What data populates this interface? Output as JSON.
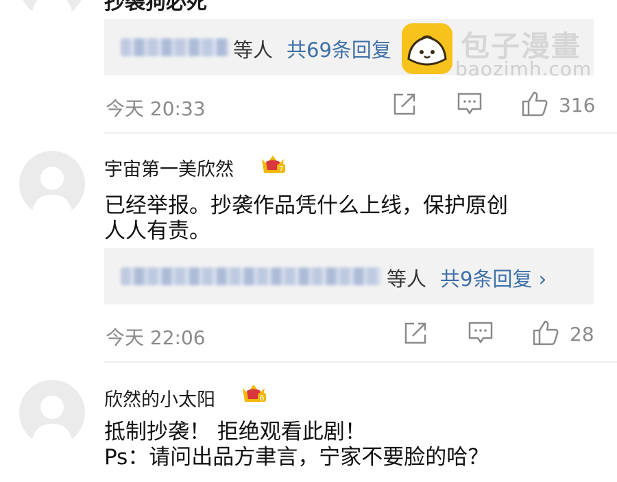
{
  "comment_top": {
    "username_partial": "抄袭狗必死",
    "reply_suffix": "等人",
    "reply_link": "共69条回复",
    "time": "今天 20:33",
    "likes": "316"
  },
  "comment_2": {
    "username": "宇宙第一美欣然",
    "badge_level": "7",
    "content_line1": "已经举报。抄袭作品凭什么上线，保护原创",
    "content_line2": "人人有责。",
    "reply_suffix": "等人",
    "reply_link": "共9条回复 ›",
    "time": "今天 22:06",
    "likes": "28"
  },
  "comment_3": {
    "username": "欣然的小太阳",
    "badge_level": "6",
    "content_line1": "抵制抄袭！ 拒绝观看此剧！",
    "content_line2": "Ps：请问出品方聿言，宁家不要脸的哈？"
  },
  "watermark": {
    "title": "包子漫畫",
    "url": "baozimh.com"
  },
  "colors": {
    "link": "#3d6fa8",
    "meta": "#8a8a8a",
    "reply_bg": "#f2f2f2",
    "badge_gold": "#f2b705",
    "badge_red": "#d9363e"
  }
}
